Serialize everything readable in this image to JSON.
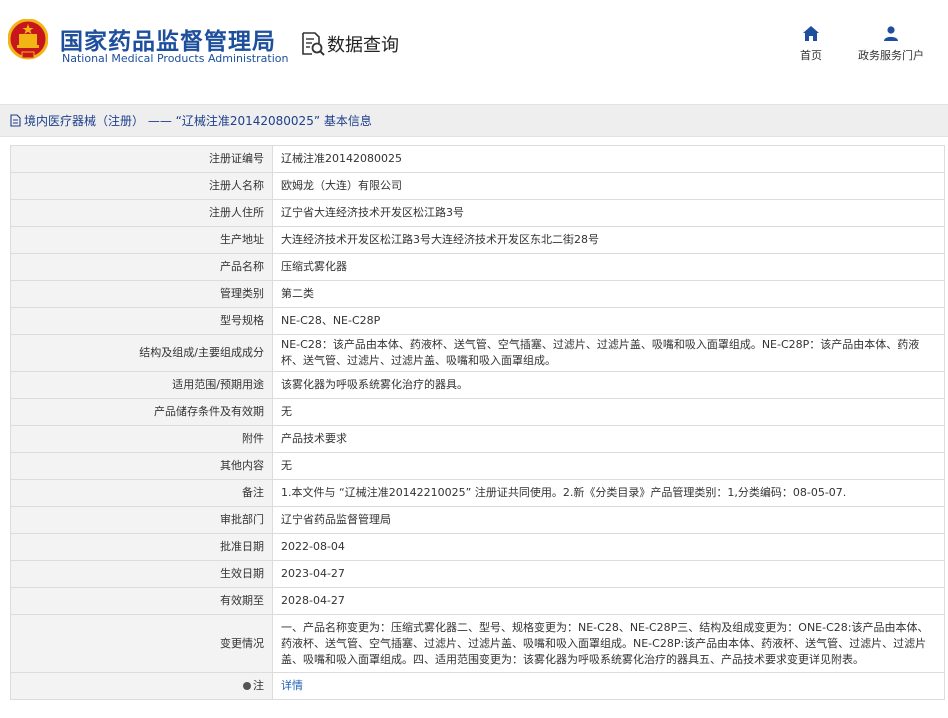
{
  "header": {
    "site_title_cn": "国家药品监督管理局",
    "site_title_en": "National Medical Products Administration",
    "query_label": "数据查询",
    "nav": [
      {
        "label": "首页",
        "icon": "home-icon"
      },
      {
        "label": "政务服务门户",
        "icon": "user-icon"
      }
    ]
  },
  "breadcrumb": {
    "text": "境内医疗器械（注册） —— “辽械注准20142080025” 基本信息"
  },
  "rows": [
    {
      "label": "注册证编号",
      "value": "辽械注准20142080025"
    },
    {
      "label": "注册人名称",
      "value": "欧姆龙（大连）有限公司"
    },
    {
      "label": "注册人住所",
      "value": "辽宁省大连经济技术开发区松江路3号"
    },
    {
      "label": "生产地址",
      "value": "大连经济技术开发区松江路3号大连经济技术开发区东北二街28号"
    },
    {
      "label": "产品名称",
      "value": "压缩式雾化器"
    },
    {
      "label": "管理类别",
      "value": "第二类"
    },
    {
      "label": "型号规格",
      "value": "NE-C28、NE-C28P"
    },
    {
      "label": "结构及组成/主要组成成分",
      "value": "NE-C28：该产品由本体、药液杯、送气管、空气插塞、过滤片、过滤片盖、吸嘴和吸入面罩组成。NE-C28P：该产品由本体、药液杯、送气管、过滤片、过滤片盖、吸嘴和吸入面罩组成。"
    },
    {
      "label": "适用范围/预期用途",
      "value": "该雾化器为呼吸系统雾化治疗的器具。"
    },
    {
      "label": "产品储存条件及有效期",
      "value": "无"
    },
    {
      "label": "附件",
      "value": "产品技术要求"
    },
    {
      "label": "其他内容",
      "value": "无"
    },
    {
      "label": "备注",
      "value": "1.本文件与 “辽械注准20142210025” 注册证共同使用。2.新《分类目录》产品管理类别：1,分类编码：08-05-07."
    },
    {
      "label": "审批部门",
      "value": "辽宁省药品监督管理局"
    },
    {
      "label": "批准日期",
      "value": "2022-08-04"
    },
    {
      "label": "生效日期",
      "value": "2023-04-27"
    },
    {
      "label": "有效期至",
      "value": "2028-04-27"
    },
    {
      "label": "变更情况",
      "value": "一、产品名称变更为：压缩式雾化器二、型号、规格变更为：NE-C28、NE-C28P三、结构及组成变更为：ONE-C28:该产品由本体、药液杯、送气管、空气插塞、过滤片、过滤片盖、吸嘴和吸入面罩组成。NE-C28P:该产品由本体、药液杯、送气管、过滤片、过滤片盖、吸嘴和吸入面罩组成。四、适用范围变更为：该雾化器为呼吸系统雾化治疗的器具五、产品技术要求变更详见附表。"
    }
  ],
  "note_row": {
    "label": "注",
    "link": "详情"
  },
  "colors": {
    "brand_blue": "#1d4f9c",
    "link_blue": "#1d5fb8",
    "label_bg": "#f3f3f3",
    "emblem_red": "#c8161d",
    "emblem_gold": "#f2b514"
  }
}
